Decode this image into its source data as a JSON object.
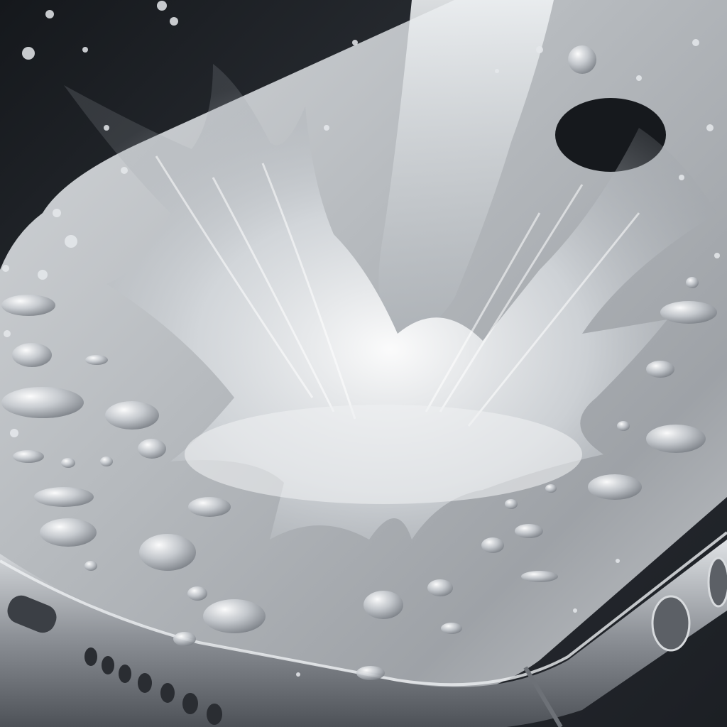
{
  "scene": {
    "subject": "water-splash-on-phone",
    "palette": {
      "background_dark": "#1e2126",
      "phone_surface": "#b9bcc0",
      "phone_highlight": "#e6e8ea",
      "phone_edge": "#8c9096",
      "water_light": "#f4f6f8",
      "water_mid": "#c6cacf",
      "droplet_shadow": "#6f747b"
    }
  }
}
